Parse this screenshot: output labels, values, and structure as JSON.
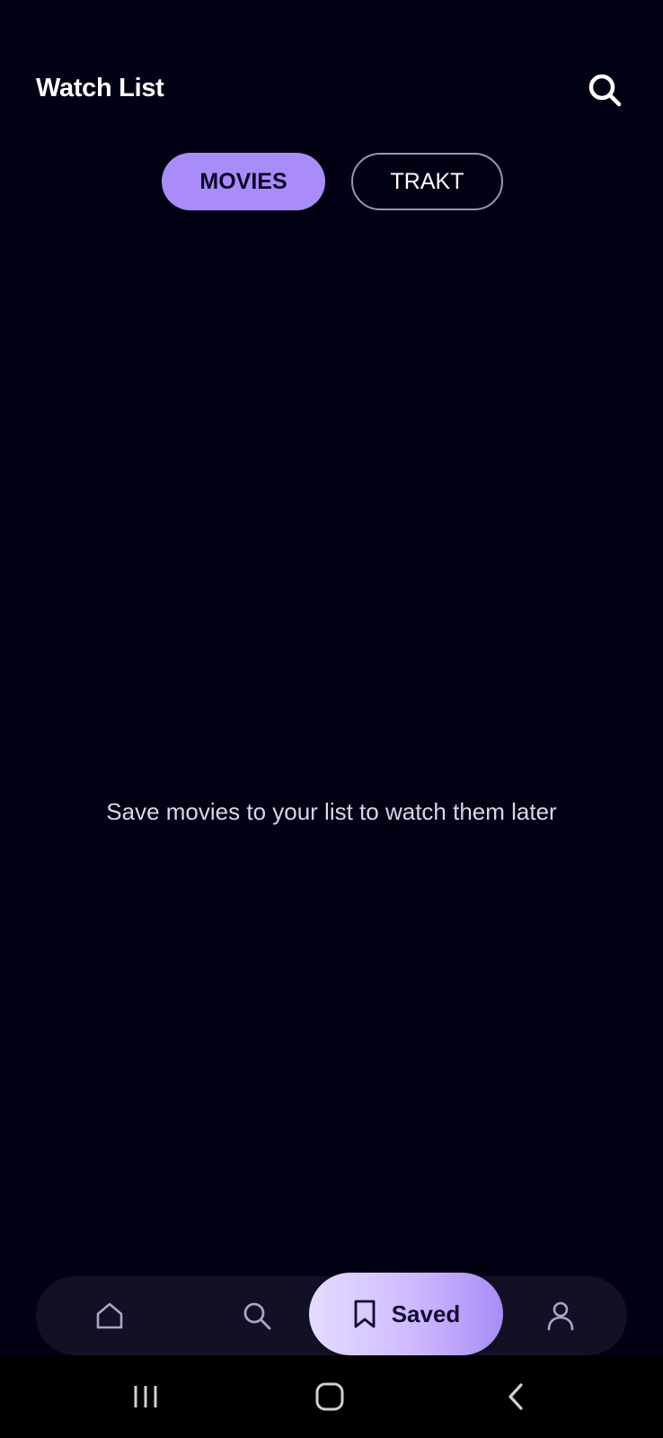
{
  "header": {
    "title": "Watch List",
    "search_icon": "search-icon"
  },
  "tabs": [
    {
      "label": "MOVIES",
      "active": true
    },
    {
      "label": "TRAKT",
      "active": false
    }
  ],
  "empty_state": {
    "message": "Save movies to your list to watch them later"
  },
  "bottom_nav": {
    "items": [
      {
        "icon": "home-icon",
        "label": "",
        "active": false
      },
      {
        "icon": "search-icon",
        "label": "",
        "active": false
      },
      {
        "icon": "bookmark-icon",
        "label": "Saved",
        "active": true
      },
      {
        "icon": "profile-icon",
        "label": "",
        "active": false
      }
    ]
  },
  "system_nav": {
    "buttons": [
      "recents-icon",
      "home-button-icon",
      "back-icon"
    ]
  },
  "colors": {
    "background": "#020114",
    "accent": "#a98cf9",
    "nav_background": "#121024",
    "text_muted": "#d9d7e4"
  }
}
